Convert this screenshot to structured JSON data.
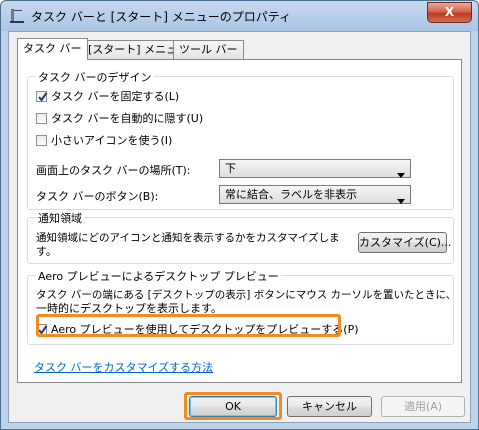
{
  "window": {
    "title": "タスク バーと [スタート] メニューのプロパティ",
    "close_label": "X"
  },
  "tabs": [
    {
      "label": "タスク バー",
      "selected": true
    },
    {
      "label": "[スタート] メニュー",
      "selected": false
    },
    {
      "label": "ツール バー",
      "selected": false
    }
  ],
  "design_group": {
    "title": "タスク バーのデザイン",
    "checkboxes": [
      {
        "label": "タスク バーを固定する(L)",
        "checked": true
      },
      {
        "label": "タスク バーを自動的に隠す(U)",
        "checked": false
      },
      {
        "label": "小さいアイコンを使う(I)",
        "checked": false
      }
    ],
    "location_label": "画面上のタスク バーの場所(T):",
    "location_value": "下",
    "buttons_label": "タスク バーのボタン(B):",
    "buttons_value": "常に結合、ラベルを非表示"
  },
  "notify_group": {
    "title": "通知領域",
    "text_line1": "通知領域にどのアイコンと通知を表示するかをカスタマイズしま",
    "text_line2": "す。",
    "customize_button": "カスタマイズ(C)..."
  },
  "aero_group": {
    "title": "Aero プレビューによるデスクトップ プレビュー",
    "text_line1": "タスク バーの端にある [デスクトップの表示] ボタンにマウス カーソルを置いたときに、",
    "text_line2": "一時的にデスクトップを表示します。",
    "checkbox_label": "Aero プレビューを使用してデスクトップをプレビューする(P)",
    "checkbox_checked": true
  },
  "help_link": "タスク バーをカスタマイズする方法",
  "footer": {
    "ok": "OK",
    "cancel": "キャンセル",
    "apply": "適用(A)"
  },
  "colors": {
    "highlight": "#f28c1e",
    "link": "#0066cc",
    "close": "#c7452a"
  }
}
